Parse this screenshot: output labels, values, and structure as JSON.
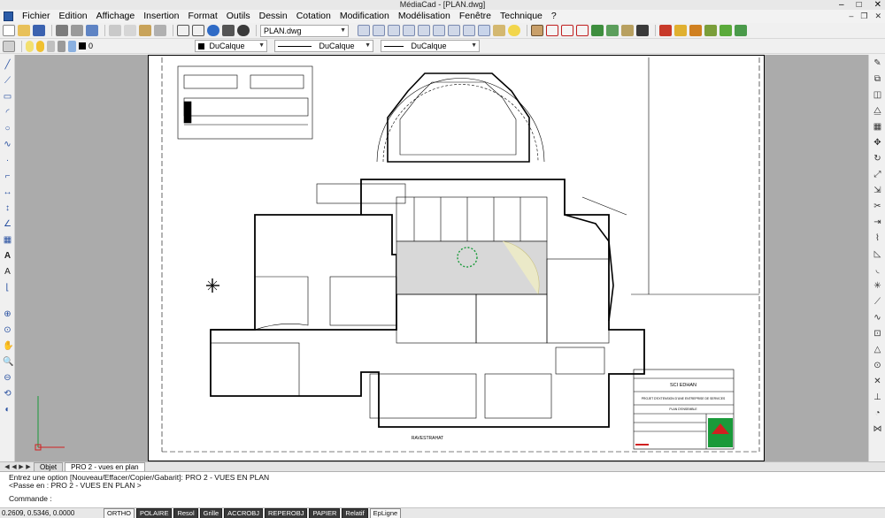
{
  "window": {
    "title": "MédiaCad - [PLAN.dwg]"
  },
  "menu": [
    "Fichier",
    "Edition",
    "Affichage",
    "Insertion",
    "Format",
    "Outils",
    "Dessin",
    "Cotation",
    "Modification",
    "Modélisation",
    "Fenêtre",
    "Technique",
    "?"
  ],
  "toolbar": {
    "drawing_combo": "PLAN.dwg"
  },
  "properties_bar": {
    "layer": "0",
    "color": "DuCalque",
    "linetype": "DuCalque",
    "lineweight": "DuCalque"
  },
  "drawing": {
    "title_block_name": "SCI EDHAN",
    "plan_label": "RAVESTRAHAT",
    "title_block_text_1": "PROJET D'EXTENSION D'UNE ENTREPRISE DE SERVICES",
    "title_block_text_2": "PLAN D'ENSEMBLE",
    "accent_green": "#1a9a3a",
    "accent_red": "#d02020",
    "accent_blue": "#1060b0"
  },
  "tabs": [
    "Objet",
    "PRO 2 - vues en plan"
  ],
  "active_tab": "PRO 2 - vues en plan",
  "command": {
    "line1": "Entrez une option [Nouveau/Effacer/Copier/Gabarit]: PRO 2 - VUES EN PLAN",
    "line2": "<Passe en : PRO 2 - VUES EN PLAN >",
    "prompt": "Commande :"
  },
  "status": {
    "coordinates": "0.2609, 0.5346, 0.0000",
    "buttons": [
      {
        "label": "ORTHO",
        "on": false
      },
      {
        "label": "POLAIRE",
        "on": true
      },
      {
        "label": "Resol",
        "on": true
      },
      {
        "label": "Grille",
        "on": true
      },
      {
        "label": "ACCROBJ",
        "on": true
      },
      {
        "label": "REPEROBJ",
        "on": true
      },
      {
        "label": "PAPIER",
        "on": true
      },
      {
        "label": "Relatif",
        "on": true
      },
      {
        "label": "EpLigne",
        "on": false
      }
    ]
  }
}
